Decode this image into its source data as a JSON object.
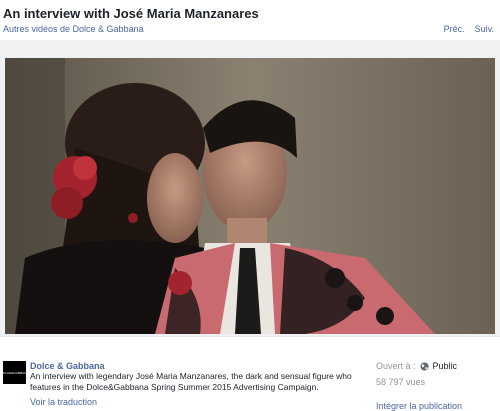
{
  "header": {
    "title": "An interview with José Maria Manzanares",
    "more_videos": "Autres vidéos de Dolce & Gabbana",
    "prev": "Préc.",
    "next": "Suiv."
  },
  "video": {
    "thumbnail": "couple-portrait-thumbnail"
  },
  "page": {
    "logo_text": "DOLCE&GABBANA",
    "name": "Dolce & Gabbana",
    "description": "An interview with legendary José Maria Manzanares, the dark and sensual figure who features in the Dolce&Gabbana Spring Summer 2015 Advertising Campaign.",
    "translate": "Voir la traduction"
  },
  "meta": {
    "privacy_label": "Ouvert à :",
    "privacy_value": "Public",
    "privacy_icon": "globe-icon",
    "views": "58 797 vues",
    "embed": "Intégrer la publication"
  },
  "colors": {
    "link": "#4b67a1",
    "muted": "#90949c",
    "text": "#1d2129"
  }
}
